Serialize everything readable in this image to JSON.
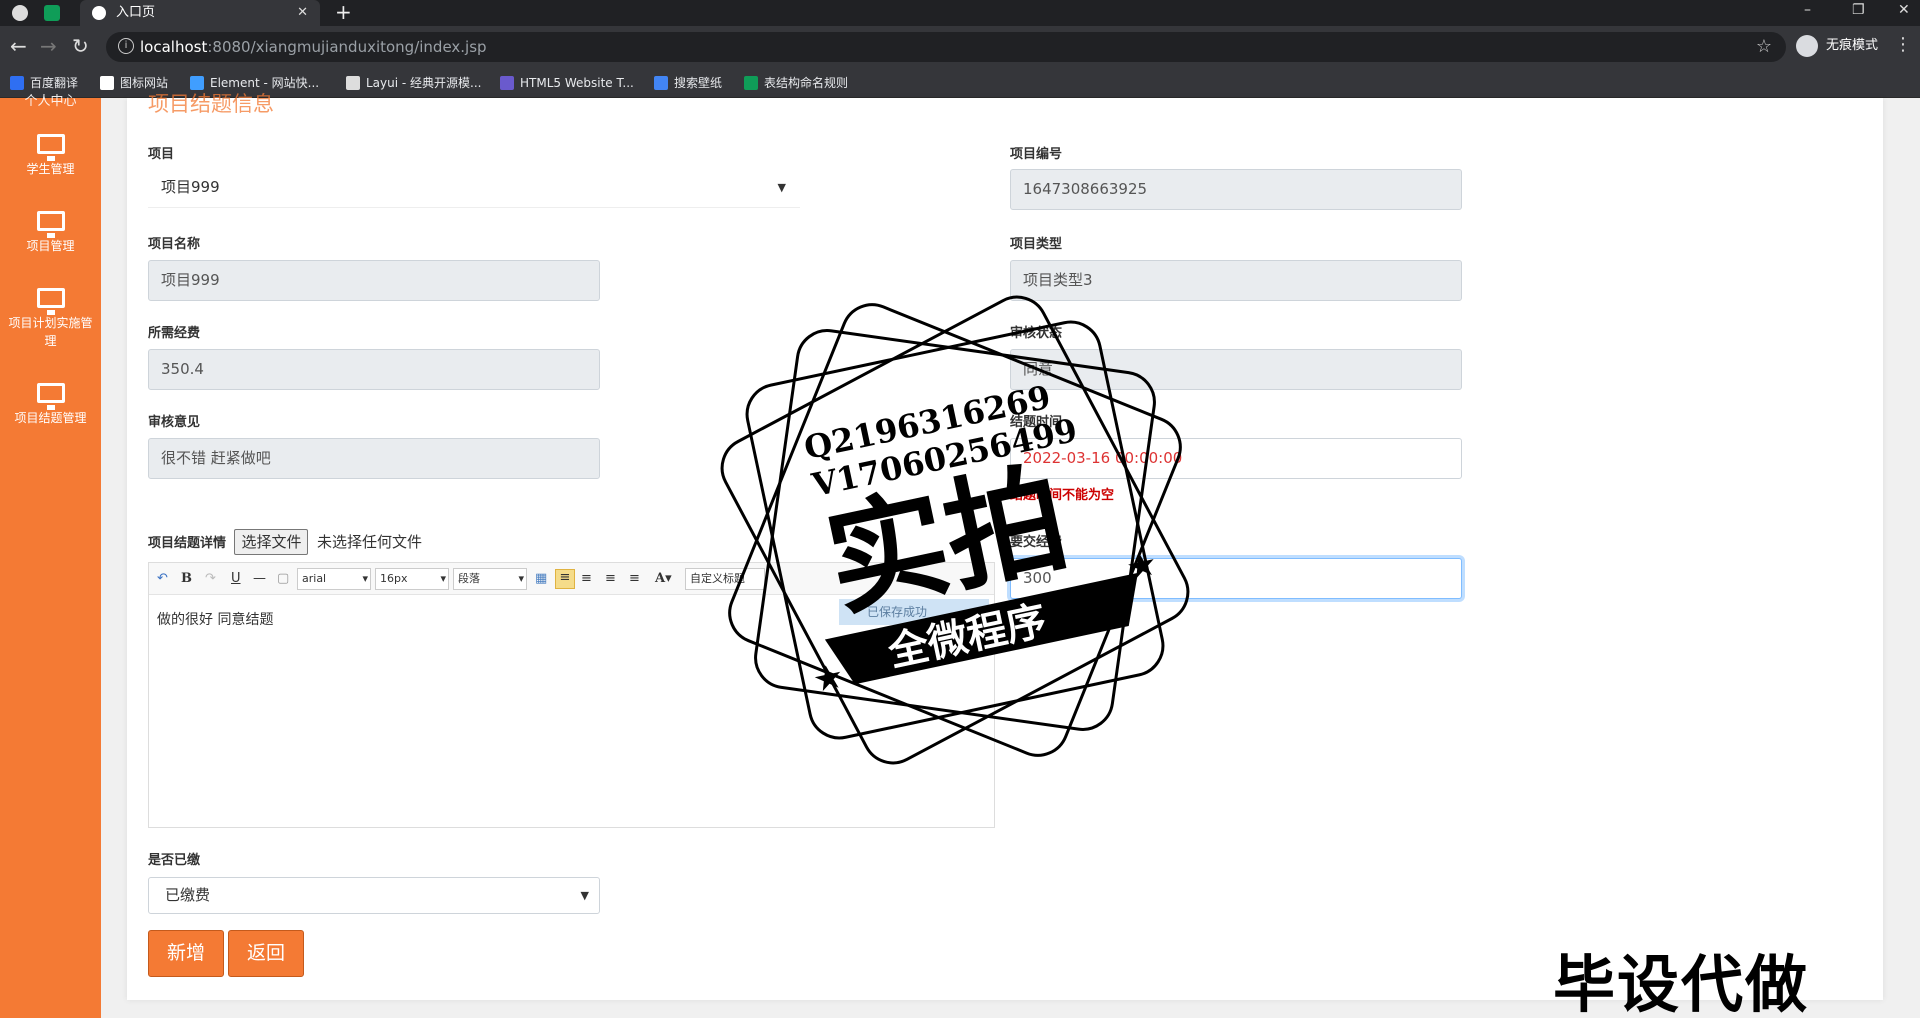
{
  "browser": {
    "tab_title": "入口页",
    "url_host": "localhost",
    "url_path": ":8080/xiangmujianduxitong/index.jsp",
    "incognito_label": "无痕模式",
    "bookmarks": [
      {
        "label": "百度翻译",
        "color": "#2f6ff2"
      },
      {
        "label": "图标网站",
        "color": "#fff"
      },
      {
        "label": "Element - 网站快...",
        "color": "#409eff"
      },
      {
        "label": "Layui - 经典开源模...",
        "color": "#ddd"
      },
      {
        "label": "HTML5 Website T...",
        "color": "#6a5acd"
      },
      {
        "label": "搜索壁纸",
        "color": "#4285f4"
      },
      {
        "label": "表结构命名规则",
        "color": "#0f9d58"
      }
    ]
  },
  "sidebar": {
    "top_label": "个人中心",
    "items": [
      {
        "label": "学生管理",
        "icon": "monitor-icon"
      },
      {
        "label": "项目管理",
        "icon": "monitor-icon"
      },
      {
        "label": "项目计划实施管理",
        "icon": "monitor-icon"
      },
      {
        "label": "项目结题管理",
        "icon": "monitor-icon"
      }
    ]
  },
  "form": {
    "section_title": "项目结题信息",
    "project_label": "项目",
    "project_value": "项目999",
    "project_no_label": "项目编号",
    "project_no_value": "1647308663925",
    "project_name_label": "项目名称",
    "project_name_value": "项目999",
    "project_type_label": "项目类型",
    "project_type_value": "项目类型3",
    "fee_label": "所需经费",
    "fee_value": "350.4",
    "audit_status_label": "审核状态",
    "audit_status_value": "同意",
    "audit_opinion_label": "审核意见",
    "audit_opinion_value": "很不错 赶紧做吧",
    "time_label": "结题时间",
    "time_value": "2022-03-16 00:00:00",
    "time_error": "结题时间不能为空",
    "need_fee_label": "要交经费",
    "need_fee_value": "300",
    "detail_label": "项目结题详情",
    "file_button": "选择文件",
    "file_none": "未选择任何文件",
    "editor": {
      "font": "arial",
      "size": "16px",
      "paragraph": "段落",
      "custom_title": "自定义标题",
      "content": "做的很好  同意结题",
      "toast": "已保存成功"
    },
    "paid_label": "是否已缴",
    "paid_value": "已缴费",
    "add_button": "新增",
    "back_button": "返回"
  },
  "watermark": {
    "qq": "Q2196316269",
    "wechat": "V17060256499",
    "main": "实拍",
    "banner": "全微程序",
    "corner": "毕设代做"
  },
  "colors": {
    "accent": "#f47a34",
    "error": "#cc0000"
  }
}
